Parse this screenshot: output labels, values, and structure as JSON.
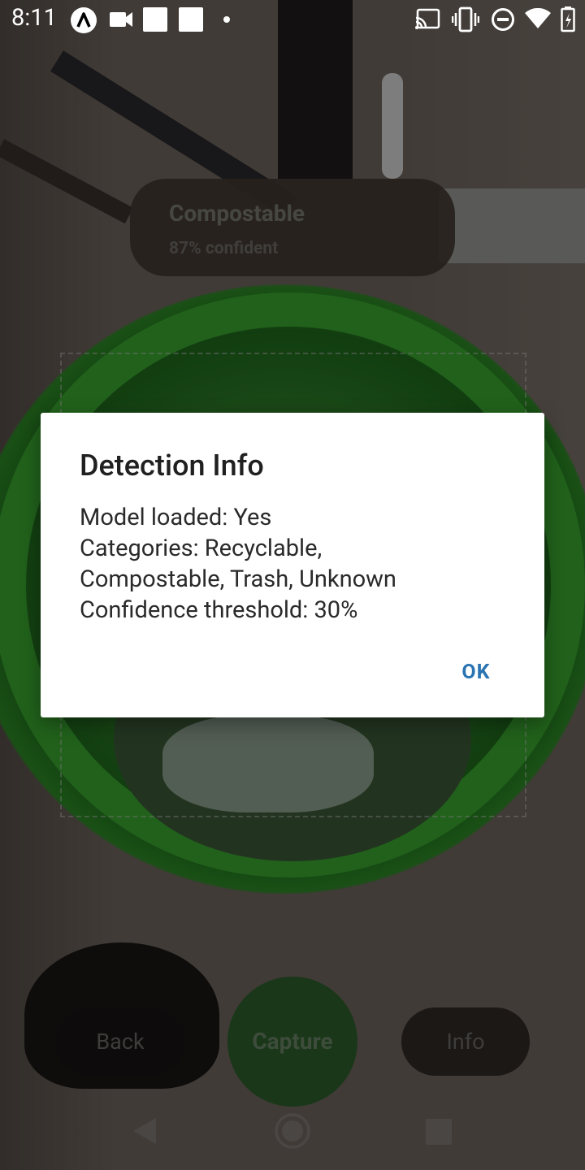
{
  "status_bar": {
    "time": "8:11",
    "left_icons": [
      "android-studio-icon",
      "video-camera-icon",
      "square-notification-icon",
      "square-notification-icon",
      "dot-icon"
    ],
    "right_icons": [
      "cast-icon",
      "vibrate-icon",
      "do-not-disturb-icon",
      "wifi-icon",
      "battery-icon"
    ]
  },
  "detection": {
    "label": "Compostable",
    "confidence": "87% confident"
  },
  "controls": {
    "back_label": "Back",
    "capture_label": "Capture",
    "info_label": "Info"
  },
  "dialog": {
    "title": "Detection Info",
    "lines": [
      "Model loaded: Yes",
      "Categories: Recyclable,",
      "Compostable, Trash, Unknown",
      "Confidence threshold: 30%"
    ],
    "ok_label": "OK"
  },
  "nav": {
    "icons": [
      "nav-back-icon",
      "nav-home-icon",
      "nav-recents-icon"
    ]
  },
  "colors": {
    "accent_button": "#2a74b2",
    "capture_green": "#2d5f2b",
    "scrim": "rgba(0,0,0,0.42)"
  }
}
